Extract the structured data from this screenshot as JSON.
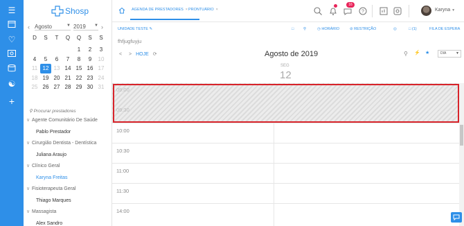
{
  "brand": {
    "logo_text": "Shosp"
  },
  "rail": {
    "icons": [
      "menu-icon",
      "calendar-icon",
      "heart-icon",
      "dollar-icon",
      "database-icon",
      "users-icon",
      "plus-icon"
    ]
  },
  "mini_calendar": {
    "month": "Agosto",
    "year": "2019",
    "weekdays": [
      "D",
      "S",
      "T",
      "Q",
      "Q",
      "S",
      "S"
    ],
    "days": [
      {
        "d": "",
        "m": false
      },
      {
        "d": "",
        "m": false
      },
      {
        "d": "",
        "m": false
      },
      {
        "d": "",
        "m": false
      },
      {
        "d": "1",
        "m": false
      },
      {
        "d": "2",
        "m": false
      },
      {
        "d": "3",
        "m": false
      },
      {
        "d": "4",
        "m": false
      },
      {
        "d": "5",
        "m": false
      },
      {
        "d": "6",
        "m": false
      },
      {
        "d": "7",
        "m": false
      },
      {
        "d": "8",
        "m": false
      },
      {
        "d": "9",
        "m": false
      },
      {
        "d": "10",
        "m": true
      },
      {
        "d": "11",
        "m": true
      },
      {
        "d": "12",
        "m": false,
        "today": true
      },
      {
        "d": "13",
        "m": true
      },
      {
        "d": "14",
        "m": false
      },
      {
        "d": "15",
        "m": false
      },
      {
        "d": "16",
        "m": false
      },
      {
        "d": "17",
        "m": true
      },
      {
        "d": "18",
        "m": true
      },
      {
        "d": "19",
        "m": false
      },
      {
        "d": "20",
        "m": false
      },
      {
        "d": "21",
        "m": false
      },
      {
        "d": "22",
        "m": false
      },
      {
        "d": "23",
        "m": false
      },
      {
        "d": "24",
        "m": true
      },
      {
        "d": "25",
        "m": true
      },
      {
        "d": "26",
        "m": false
      },
      {
        "d": "27",
        "m": false
      },
      {
        "d": "28",
        "m": false
      },
      {
        "d": "29",
        "m": false
      },
      {
        "d": "30",
        "m": false
      },
      {
        "d": "31",
        "m": true
      }
    ]
  },
  "sidebar": {
    "search_placeholder": "Procurar prestadores",
    "groups": [
      {
        "name": "Agente Comunitário De Saúde",
        "providers": [
          "Pablo Prestador"
        ]
      },
      {
        "name": "Cirurgião Dentista - Dentística",
        "providers": [
          "Juliana Araujo"
        ]
      },
      {
        "name": "Clínico Geral",
        "providers": [
          "Karyna Freitas"
        ],
        "active": "Karyna Freitas"
      },
      {
        "name": "Fisioterapeuta Geral",
        "providers": [
          "Thiago Marques"
        ]
      },
      {
        "name": "Massagista",
        "providers": [
          "Alex Sandro"
        ]
      }
    ]
  },
  "topbar": {
    "tabs": [
      "AGENDA DE PRESTADORES",
      "PRONTUÁRIO"
    ],
    "notification_count": "16",
    "user_name": "Karyna"
  },
  "toolbar": {
    "unit_label": "UNIDADE TESTE",
    "horario": "HORÁRIO",
    "restricao": "RESTRIÇÃO",
    "waitlist_count": "(1)",
    "waitlist": "FILA DE ESPERA"
  },
  "subtitle": "fhfjugfuyju",
  "calendar": {
    "today_label": "HOJE",
    "title": "Agosto de 2019",
    "day_name": "SEG",
    "day_number": "12",
    "view": "DIA",
    "blocked_hours": [
      "09:00",
      "09:30"
    ],
    "hours": [
      "10:00",
      "10:30",
      "11:00",
      "11:30",
      "14:00"
    ]
  },
  "colors": {
    "accent": "#2e8fe8",
    "highlight": "#d8232a"
  }
}
